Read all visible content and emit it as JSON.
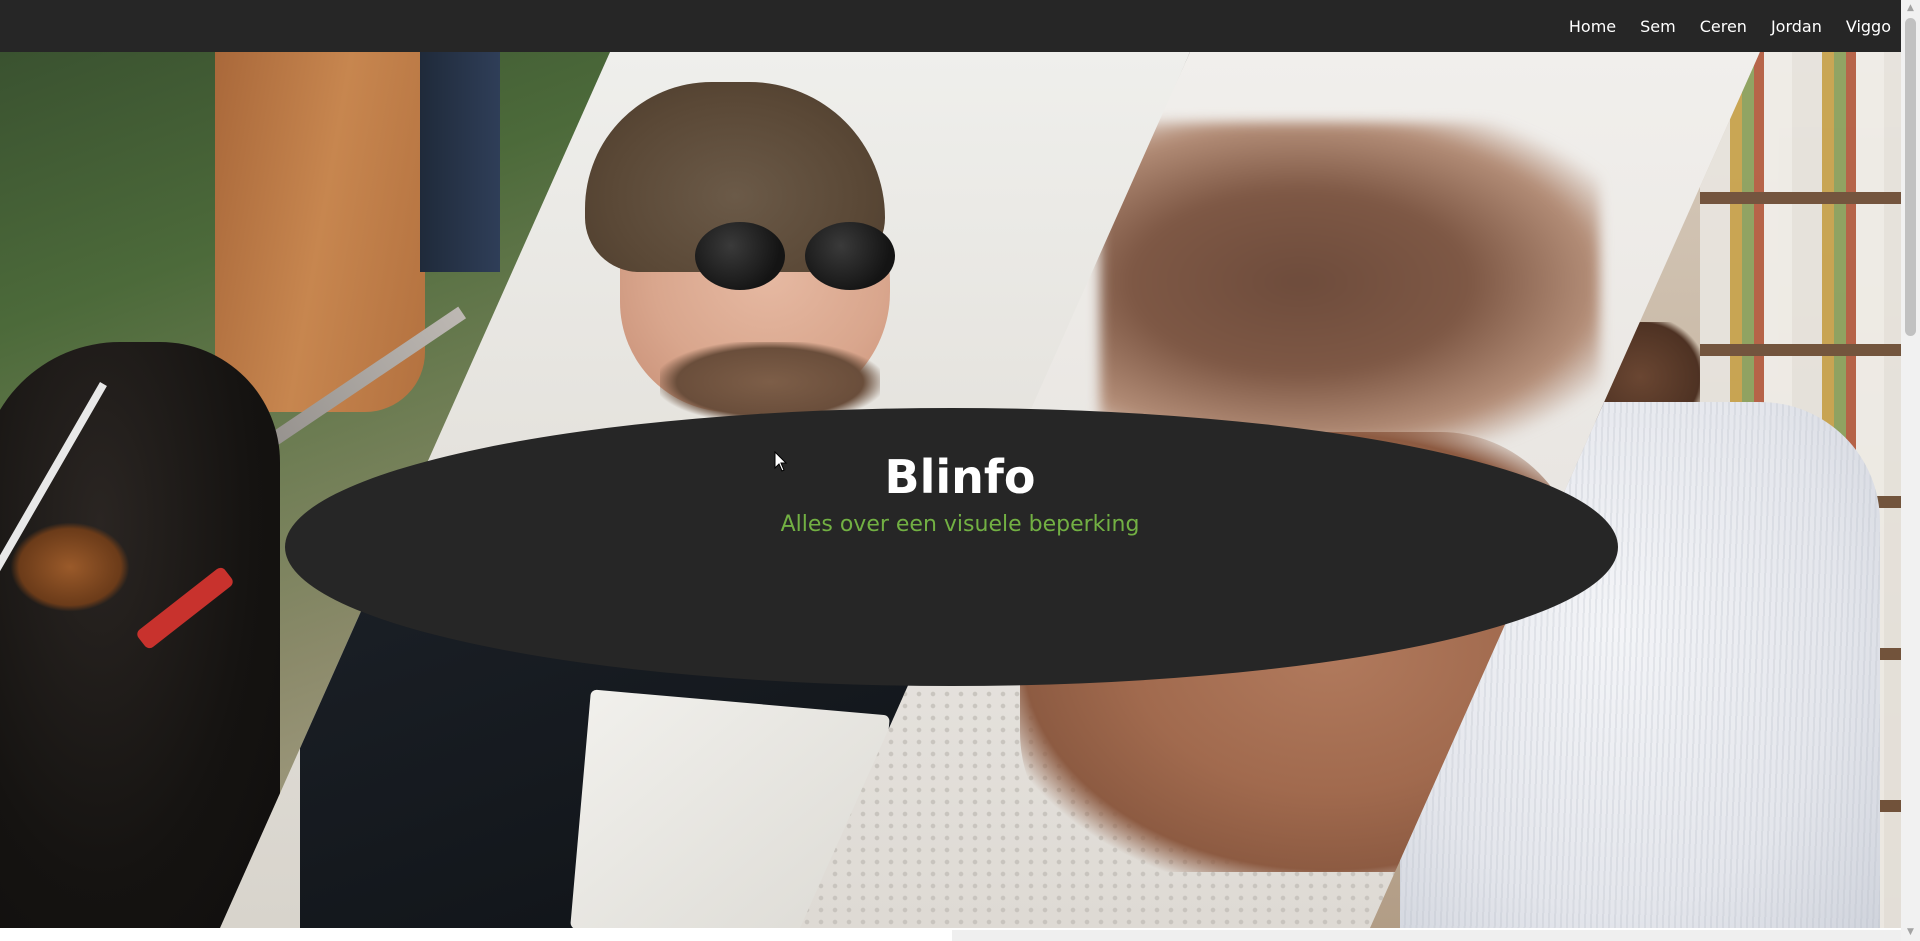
{
  "nav": {
    "links": [
      "Home",
      "Sem",
      "Ceren",
      "Jordan",
      "Viggo"
    ]
  },
  "hero": {
    "title": "Blinfo",
    "subtitle": "Alles over een visuele beperking"
  },
  "colors": {
    "navbar": "#262626",
    "ellipse": "#262626",
    "title": "#ffffff",
    "subtitle_accent": "#72b043"
  },
  "icons": {
    "cursor": "mouse-pointer-icon",
    "scroll_up": "chevron-up-icon",
    "scroll_down": "chevron-down-icon"
  }
}
